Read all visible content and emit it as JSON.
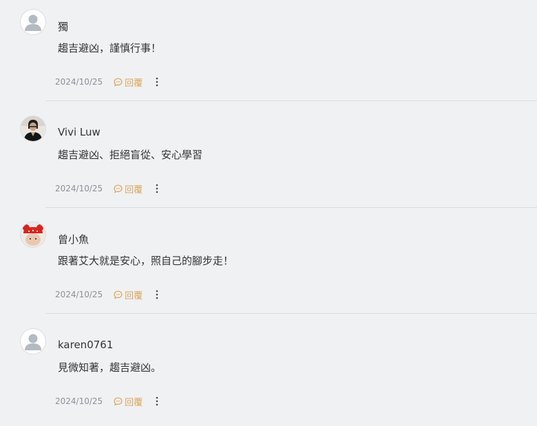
{
  "comments": [
    {
      "avatar": "default-avatar-icon",
      "username": "獨",
      "text": "趨吉避凶，謹慎行事！",
      "date": "2024/10/25",
      "reply_label": "回覆"
    },
    {
      "avatar": "profile-photo",
      "username": "Vivi Luw",
      "text": "趨吉避凶、拒絕盲從、安心學習",
      "date": "2024/10/25",
      "reply_label": "回覆"
    },
    {
      "avatar": "profile-photo-red-hat",
      "username": "曾小魚",
      "text": "跟著艾大就是安心，照自己的腳步走！",
      "date": "2024/10/25",
      "reply_label": "回覆"
    },
    {
      "avatar": "default-avatar-icon",
      "username": "karen0761",
      "text": "見微知著，趨吉避凶。",
      "date": "2024/10/25",
      "reply_label": "回覆"
    }
  ],
  "colors": {
    "background": "#f0f1f3",
    "reply_accent": "#d9a55a",
    "meta_text": "#8b8f96",
    "divider": "#dcdde0"
  },
  "icons": {
    "reply": "chat-bubble-icon",
    "more": "vertical-dots-icon"
  }
}
